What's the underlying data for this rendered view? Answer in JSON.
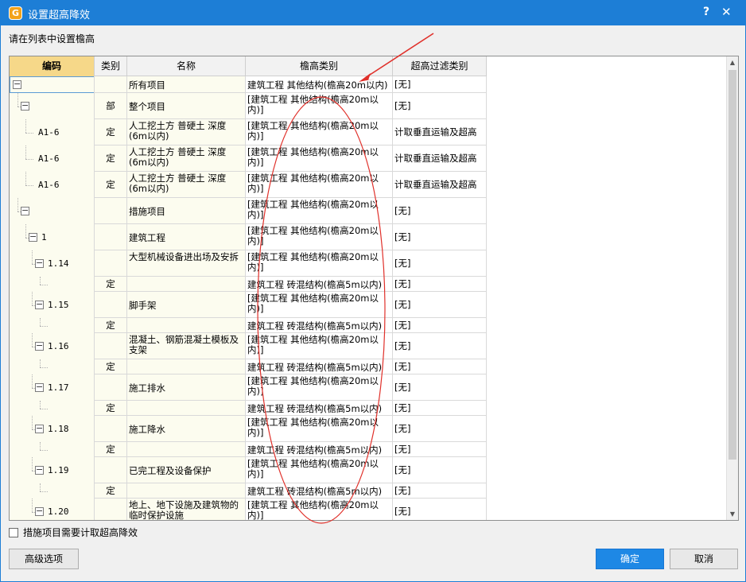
{
  "window": {
    "title": "设置超高降效",
    "help_glyph": "?",
    "close_glyph": "✕",
    "icon_glyph": "G"
  },
  "prompt": "请在列表中设置檐高",
  "columns": [
    "编码",
    "类别",
    "名称",
    "檐高类别",
    "超高过滤类别"
  ],
  "rows": [
    {
      "level": 0,
      "toggle": "−",
      "code": "",
      "type": "",
      "name": "所有项目",
      "eave": "建筑工程 其他结构(檐高20m以内)",
      "filter": "[无]",
      "selected": true
    },
    {
      "level": 1,
      "toggle": "−",
      "code": "",
      "type": "部",
      "name": "整个项目",
      "eave": "[建筑工程 其他结构(檐高20m以内)]",
      "filter": "[无]"
    },
    {
      "level": 2,
      "toggle": "",
      "code": "A1-6",
      "type": "定",
      "name": "人工挖土方 普硬土 深度(6m以内)",
      "eave": "[建筑工程 其他结构(檐高20m以内)]",
      "filter": "计取垂直运输及超高"
    },
    {
      "level": 2,
      "toggle": "",
      "code": "A1-6",
      "type": "定",
      "name": "人工挖土方 普硬土 深度(6m以内)",
      "eave": "[建筑工程 其他结构(檐高20m以内)]",
      "filter": "计取垂直运输及超高"
    },
    {
      "level": 2,
      "toggle": "",
      "code": "A1-6",
      "type": "定",
      "name": "人工挖土方 普硬土 深度(6m以内)",
      "eave": "[建筑工程 其他结构(檐高20m以内)]",
      "filter": "计取垂直运输及超高"
    },
    {
      "level": 1,
      "toggle": "−",
      "code": "",
      "type": "",
      "name": "措施项目",
      "eave": "[建筑工程 其他结构(檐高20m以内)]",
      "filter": "[无]"
    },
    {
      "level": 2,
      "toggle": "−",
      "code": "1",
      "type": "",
      "name": "建筑工程",
      "eave": "[建筑工程 其他结构(檐高20m以内)]",
      "filter": "[无]"
    },
    {
      "level": 3,
      "toggle": "−",
      "code": "1.14",
      "type": "",
      "name": "大型机械设备进出场及安拆",
      "eave": "[建筑工程 其他结构(檐高20m以内)]",
      "filter": "[无]"
    },
    {
      "level": 4,
      "toggle": "",
      "code": "",
      "type": "定",
      "name": "",
      "eave": "建筑工程 砖混结构(檐高5m以内)",
      "filter": "[无]"
    },
    {
      "level": 3,
      "toggle": "−",
      "code": "1.15",
      "type": "",
      "name": "脚手架",
      "eave": "[建筑工程 其他结构(檐高20m以内)]",
      "filter": "[无]"
    },
    {
      "level": 4,
      "toggle": "",
      "code": "",
      "type": "定",
      "name": "",
      "eave": "建筑工程 砖混结构(檐高5m以内)",
      "filter": "[无]"
    },
    {
      "level": 3,
      "toggle": "−",
      "code": "1.16",
      "type": "",
      "name": "混凝土、钢筋混凝土模板及支架",
      "eave": "[建筑工程 其他结构(檐高20m以内)]",
      "filter": "[无]"
    },
    {
      "level": 4,
      "toggle": "",
      "code": "",
      "type": "定",
      "name": "",
      "eave": "建筑工程 砖混结构(檐高5m以内)",
      "filter": "[无]"
    },
    {
      "level": 3,
      "toggle": "−",
      "code": "1.17",
      "type": "",
      "name": "施工排水",
      "eave": "[建筑工程 其他结构(檐高20m以内)]",
      "filter": "[无]"
    },
    {
      "level": 4,
      "toggle": "",
      "code": "",
      "type": "定",
      "name": "",
      "eave": "建筑工程 砖混结构(檐高5m以内)",
      "filter": "[无]"
    },
    {
      "level": 3,
      "toggle": "−",
      "code": "1.18",
      "type": "",
      "name": "施工降水",
      "eave": "[建筑工程 其他结构(檐高20m以内)]",
      "filter": "[无]"
    },
    {
      "level": 4,
      "toggle": "",
      "code": "",
      "type": "定",
      "name": "",
      "eave": "建筑工程 砖混结构(檐高5m以内)",
      "filter": "[无]"
    },
    {
      "level": 3,
      "toggle": "−",
      "code": "1.19",
      "type": "",
      "name": "已完工程及设备保护",
      "eave": "[建筑工程 其他结构(檐高20m以内)]",
      "filter": "[无]"
    },
    {
      "level": 4,
      "toggle": "",
      "code": "",
      "type": "定",
      "name": "",
      "eave": "建筑工程 砖混结构(檐高5m以内)",
      "filter": "[无]"
    },
    {
      "level": 3,
      "toggle": "−",
      "code": "1.20",
      "type": "",
      "name": "地上、地下设施及建筑物的临时保护设施",
      "eave": "[建筑工程 其他结构(檐高20m以内)]",
      "filter": "[无]"
    }
  ],
  "checkbox": {
    "label": "措施项目需要计取超高降效",
    "checked": false
  },
  "buttons": {
    "advanced": "高级选项",
    "ok": "确定",
    "cancel": "取消"
  },
  "colors": {
    "titlebar": "#1d7ed6",
    "header_code": "#f6d889",
    "annotation": "#e0302a"
  }
}
